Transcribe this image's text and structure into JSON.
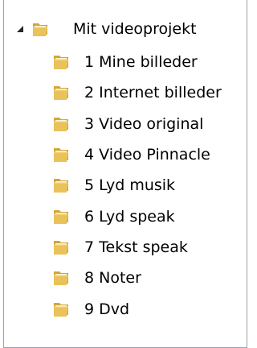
{
  "tree": {
    "root": {
      "label": "Mit videoprojekt",
      "icon": "folder-icon",
      "expanded": true
    },
    "children": [
      {
        "label": "1 Mine billeder",
        "icon": "folder-icon"
      },
      {
        "label": "2 Internet billeder",
        "icon": "folder-icon"
      },
      {
        "label": "3 Video original",
        "icon": "folder-icon"
      },
      {
        "label": "4 Video Pinnacle",
        "icon": "folder-icon"
      },
      {
        "label": "5 Lyd musik",
        "icon": "folder-icon"
      },
      {
        "label": "6 Lyd speak",
        "icon": "folder-icon"
      },
      {
        "label": "7 Tekst speak",
        "icon": "folder-icon"
      },
      {
        "label": "8 Noter",
        "icon": "folder-icon"
      },
      {
        "label": "9 Dvd",
        "icon": "folder-icon"
      }
    ]
  },
  "colors": {
    "folder_front": "#e9c25a",
    "folder_back": "#d4a537",
    "folder_paper": "#fbf3d2",
    "border": "#9aa2ad",
    "expander": "#262626"
  }
}
